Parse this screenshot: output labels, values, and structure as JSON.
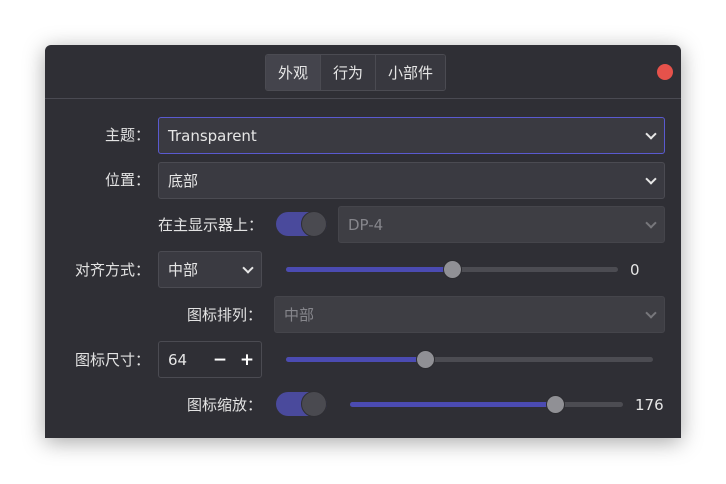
{
  "tabs": [
    {
      "label": "外观"
    },
    {
      "label": "行为"
    },
    {
      "label": "小部件"
    }
  ],
  "theme": {
    "label": "主题：",
    "value": "Transparent"
  },
  "position": {
    "label": "位置：",
    "value": "底部"
  },
  "primary_display": {
    "label": "在主显示器上：",
    "toggle_on": true,
    "value": "DP-4"
  },
  "alignment": {
    "label": "对齐方式：",
    "value": "中部",
    "offset_value": "0",
    "offset_fraction": 0.5
  },
  "icon_arrangement": {
    "label": "图标排列：",
    "value": "中部"
  },
  "icon_size": {
    "label": "图标尺寸：",
    "value": "64",
    "minus": "−",
    "plus": "+",
    "slider_fraction": 0.38
  },
  "icon_zoom": {
    "label": "图标缩放：",
    "toggle_on": true,
    "value": "176",
    "slider_fraction": 0.75
  },
  "colors": {
    "accent": "#4b4bb2",
    "window_bg": "#2f2f35",
    "close": "#e6524b"
  },
  "icons": {
    "close": "close-dot",
    "dropdown": "chevron-down-icon"
  }
}
